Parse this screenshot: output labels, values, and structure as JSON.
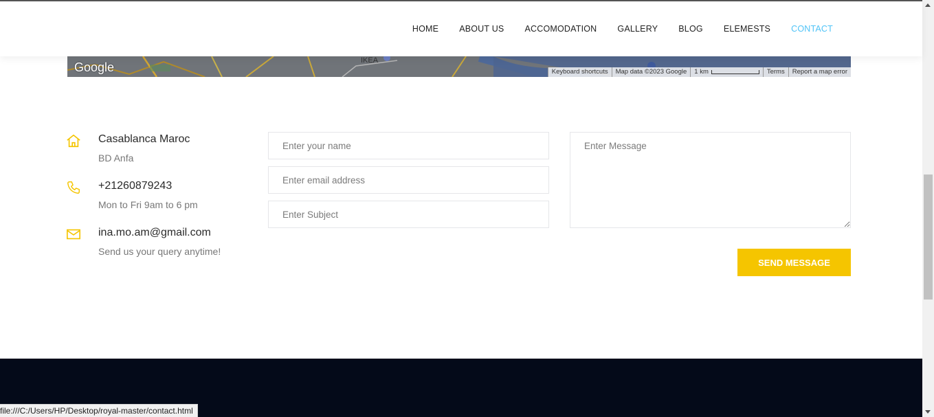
{
  "nav": {
    "items": [
      {
        "label": "HOME"
      },
      {
        "label": "ABOUT US"
      },
      {
        "label": "ACCOMODATION"
      },
      {
        "label": "GALLERY"
      },
      {
        "label": "BLOG"
      },
      {
        "label": "ELEMESTS"
      },
      {
        "label": "CONTACT"
      }
    ],
    "active": "CONTACT",
    "active_color": "#4fc3f7"
  },
  "map": {
    "logo": "Google",
    "place_label": "IKEA",
    "keyboard_shortcuts": "Keyboard shortcuts",
    "map_data": "Map data ©2023 Google",
    "scale": "1 km",
    "terms": "Terms",
    "report": "Report a map error"
  },
  "contact": {
    "address_title": "Casablanca Maroc",
    "address_sub": "BD Anfa",
    "phone_title": "+21260879243",
    "phone_sub": "Mon to Fri 9am to 6 pm",
    "email_title": "ina.mo.am@gmail.com",
    "email_sub": "Send us your query anytime!",
    "icon_color": "#f5c500"
  },
  "form": {
    "name_placeholder": "Enter your name",
    "email_placeholder": "Enter email address",
    "subject_placeholder": "Enter Subject",
    "message_placeholder": "Enter Message",
    "send_label": "SEND MESSAGE",
    "button_color": "#f5c500"
  },
  "status_bar": {
    "url": "file:///C:/Users/HP/Desktop/royal-master/contact.html"
  }
}
